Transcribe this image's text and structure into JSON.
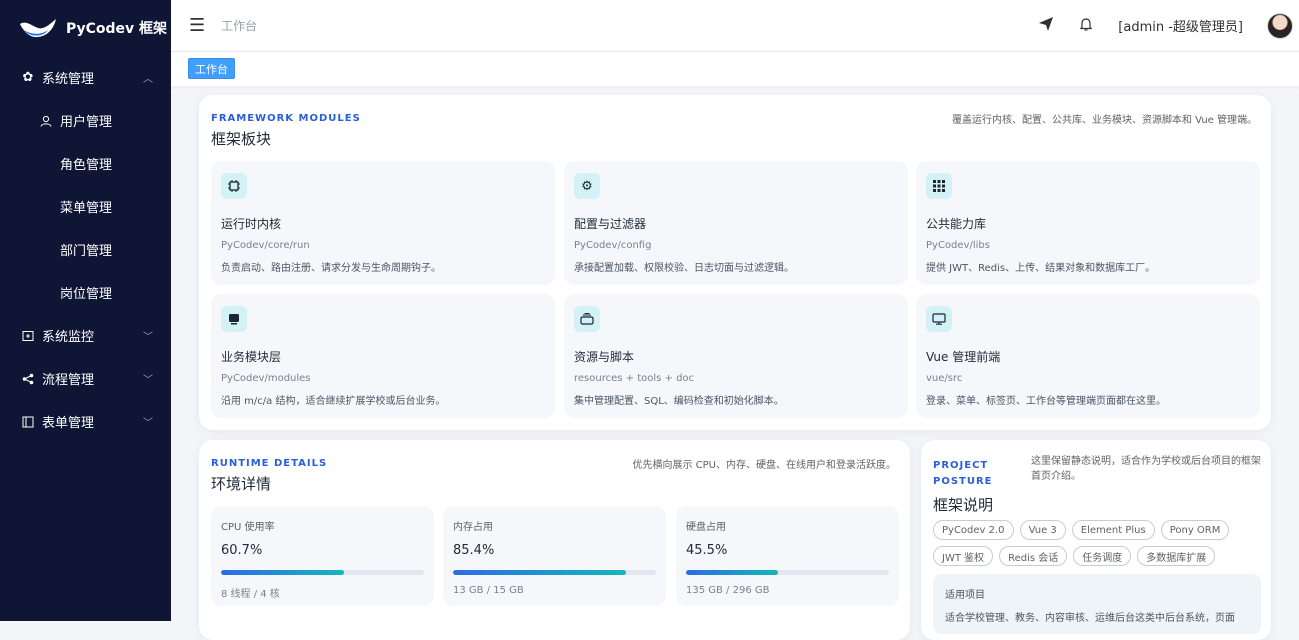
{
  "sidebar": {
    "brand": "PyCodev 框架",
    "items": [
      {
        "label": "系统管理",
        "icon": "gear-icon"
      },
      {
        "label": "用户管理",
        "icon": "user-icon"
      },
      {
        "label": "角色管理"
      },
      {
        "label": "菜单管理"
      },
      {
        "label": "部门管理"
      },
      {
        "label": "岗位管理"
      },
      {
        "label": "系统监控",
        "icon": "monitor-icon"
      },
      {
        "label": "流程管理",
        "icon": "share-icon"
      },
      {
        "label": "表单管理",
        "icon": "form-icon"
      }
    ]
  },
  "header": {
    "breadcrumb": "工作台",
    "user": "[admin -超级管理员]"
  },
  "tags": {
    "active": "工作台"
  },
  "modules": {
    "eyebrow": "FRAMEWORK MODULES",
    "title": "框架板块",
    "desc": "覆盖运行内核、配置、公共库、业务模块、资源脚本和 Vue 管理端。",
    "items": [
      {
        "icon": "chip-icon",
        "name": "运行时内核",
        "path": "PyCodev/core/run",
        "desc": "负责启动、路由注册、请求分发与生命周期钩子。"
      },
      {
        "icon": "gear-icon",
        "name": "配置与过滤器",
        "path": "PyCodev/config",
        "desc": "承接配置加载、权限校验、日志切面与过滤逻辑。"
      },
      {
        "icon": "grid-icon",
        "name": "公共能力库",
        "path": "PyCodev/libs",
        "desc": "提供 JWT、Redis、上传、结果对象和数据库工厂。"
      },
      {
        "icon": "box-icon",
        "name": "业务模块层",
        "path": "PyCodev/modules",
        "desc": "沿用 m/c/a 结构，适合继续扩展学校或后台业务。"
      },
      {
        "icon": "layers-icon",
        "name": "资源与脚本",
        "path": "resources + tools + doc",
        "desc": "集中管理配置、SQL、编码检查和初始化脚本。"
      },
      {
        "icon": "monitor-icon",
        "name": "Vue 管理前端",
        "path": "vue/src",
        "desc": "登录、菜单、标签页、工作台等管理端页面都在这里。"
      }
    ]
  },
  "runtime": {
    "eyebrow": "RUNTIME DETAILS",
    "title": "环境详情",
    "desc": "优先横向展示 CPU、内存、硬盘、在线用户和登录活跃度。",
    "metrics": [
      {
        "label": "CPU 使用率",
        "value": "60.7%",
        "percent": 60.7,
        "foot": "8 线程 / 4 核"
      },
      {
        "label": "内存占用",
        "value": "85.4%",
        "percent": 85.4,
        "foot": "13 GB / 15 GB"
      },
      {
        "label": "硬盘占用",
        "value": "45.5%",
        "percent": 45.5,
        "foot": "135 GB / 296 GB"
      }
    ]
  },
  "project": {
    "eyebrow": "PROJECT POSTURE",
    "title": "框架说明",
    "desc": "这里保留静态说明，适合作为学校或后台项目的框架首页介绍。",
    "chips": [
      "PyCodev 2.0",
      "Vue 3",
      "Element Plus",
      "Pony ORM",
      "JWT 鉴权",
      "Redis 会话",
      "任务调度",
      "多数据库扩展"
    ],
    "applicable_title": "适用项目",
    "applicable_text": "适合学校管理、教务、内容审核、运维后台这类中后台系统，页面"
  }
}
